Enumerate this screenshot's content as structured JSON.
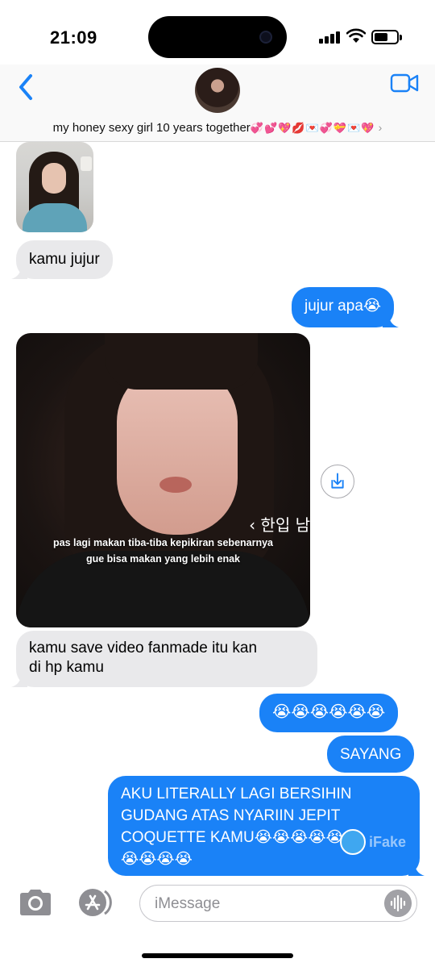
{
  "status_bar": {
    "time": "21:09"
  },
  "header": {
    "contact_name": "my honey sexy girl 10 years together",
    "contact_emoji": "💞💕💖💋💌💞💝💌💖",
    "chevron": "›"
  },
  "messages": {
    "m1": "kamu jujur",
    "m2": "jujur apa😭",
    "video_caption_1": "pas lagi makan tiba-tiba kepikiran sebenarnya",
    "video_caption_2": "gue bisa makan yang lebih enak",
    "video_overlay_korean": "‹ 한입 남",
    "m3_line1": "kamu save video fanmade itu kan",
    "m3_line2": "di hp kamu",
    "m4": "😭😭😭😭😭😭",
    "m5": "SAYANG",
    "m6_line1": "AKU LITERALLY LAGI BERSIHIN",
    "m6_line2": "GUDANG ATAS NYARIIN JEPIT",
    "m6_line3": "COQUETTE KAMU😭😭😭😭😭😭",
    "m6_line4": "😭😭😭😭"
  },
  "composer": {
    "placeholder": "iMessage"
  },
  "watermark": "iFake",
  "colors": {
    "sent_bubble": "#1a82f7",
    "received_bubble": "#e9e9eb",
    "accent": "#1a82f7"
  }
}
